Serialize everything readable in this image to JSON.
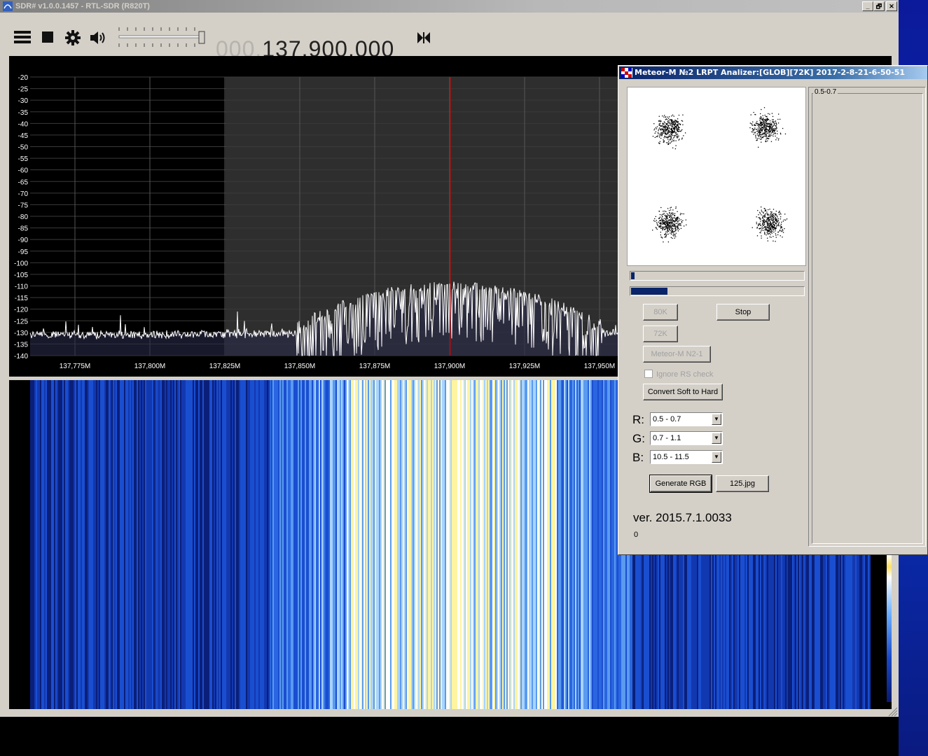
{
  "window": {
    "title": "SDR# v1.0.0.1457 - RTL-SDR (R820T)",
    "buttons": [
      "_",
      "🗗",
      "✕"
    ]
  },
  "toolbar": {
    "frequency_dim": "000.",
    "frequency_main": "137.900.000"
  },
  "spectrum": {
    "y_ticks": [
      "-20",
      "-25",
      "-30",
      "-35",
      "-40",
      "-45",
      "-50",
      "-55",
      "-60",
      "-65",
      "-70",
      "-75",
      "-80",
      "-85",
      "-90",
      "-95",
      "-100",
      "-105",
      "-110",
      "-115",
      "-120",
      "-125",
      "-130",
      "-135",
      "-140"
    ],
    "x_ticks": [
      "137,775M",
      "137,800M",
      "137,825M",
      "137,850M",
      "137,875M",
      "137,900M",
      "137,925M",
      "137,950M"
    ],
    "center_freq_label": "137,900M"
  },
  "analyzer": {
    "title": "Meteor-M №2 LRPT Analizer:[GLOB][72K] 2017-2-8-21-6-50-51",
    "btn_80k": "80K",
    "btn_stop": "Stop",
    "btn_72k": "72K",
    "btn_meteor": "Meteor-M N2-1",
    "chk_rs": "Ignore RS check",
    "btn_convert": "Convert Soft to Hard",
    "r_label": "R:",
    "g_label": "G:",
    "b_label": "B:",
    "r_value": "0.5 - 0.7",
    "g_value": "0.7 - 1.1",
    "b_value": "10.5 - 11.5",
    "btn_generate": "Generate RGB",
    "btn_jpg": "125.jpg",
    "version": "ver. 2015.7.1.0033",
    "status": "0",
    "group_label": "0.5-0.7",
    "progress1": 0.02,
    "progress2": 0.21
  },
  "colors": {
    "spectrum_bg": "#000000",
    "band_highlight": "#2e2e2e",
    "center_line": "#cc0000",
    "title_active": "#0a246a"
  }
}
